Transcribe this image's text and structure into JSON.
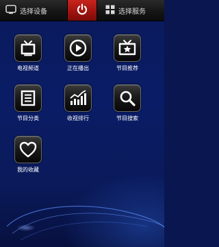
{
  "topbar": {
    "select_device": "选择设备",
    "select_service": "选择服务",
    "power_color": "#c8241e"
  },
  "tiles": [
    {
      "label": "电视频道",
      "icon": "tv-channel-icon"
    },
    {
      "label": "正在播出",
      "icon": "play-icon"
    },
    {
      "label": "节目推荐",
      "icon": "recommend-icon"
    },
    {
      "label": "节目分类",
      "icon": "list-icon"
    },
    {
      "label": "收视排行",
      "icon": "ranking-chart-icon"
    },
    {
      "label": "节目搜索",
      "icon": "search-icon"
    },
    {
      "label": "我的收藏",
      "icon": "heart-icon"
    }
  ]
}
